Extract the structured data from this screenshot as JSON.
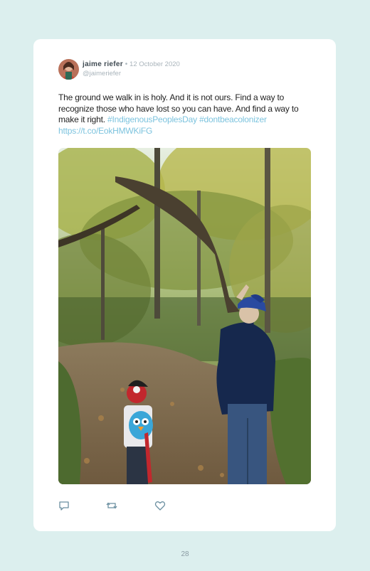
{
  "post": {
    "display_name": "jaime riefer",
    "separator": "•",
    "date": "12 October 2020",
    "handle": "@jaimeriefer",
    "text_plain": "The ground we walk in is holy. And it is not ours. Find a way to recognize those who have lost so you can have. And find a way to make it right.",
    "hashtag_1": "#IndigenousPeoplesDay",
    "hashtag_2": "#dontbeacolonizer",
    "url": "https://t.co/EokHMWKiFG"
  },
  "actions": {
    "reply_icon": "reply-icon",
    "retweet_icon": "retweet-icon",
    "like_icon": "heart-icon"
  },
  "page": {
    "number": "28"
  },
  "colors": {
    "background": "#dcefee",
    "link": "#7cc3de",
    "muted": "#a9b4bb",
    "icon": "#6b8fa0"
  }
}
